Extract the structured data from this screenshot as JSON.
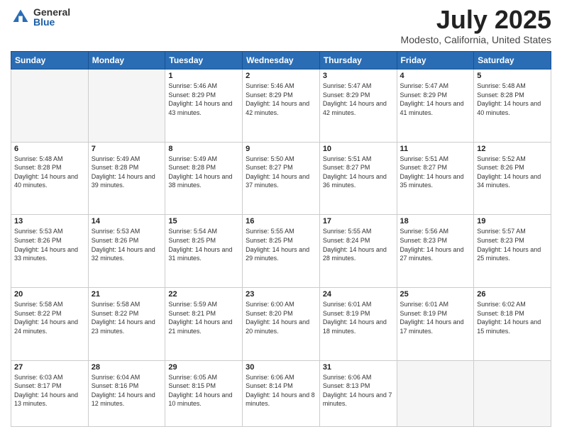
{
  "header": {
    "logo_general": "General",
    "logo_blue": "Blue",
    "month": "July 2025",
    "location": "Modesto, California, United States"
  },
  "weekdays": [
    "Sunday",
    "Monday",
    "Tuesday",
    "Wednesday",
    "Thursday",
    "Friday",
    "Saturday"
  ],
  "days": [
    {
      "num": "",
      "empty": true
    },
    {
      "num": "",
      "empty": true
    },
    {
      "num": "1",
      "sunrise": "Sunrise: 5:46 AM",
      "sunset": "Sunset: 8:29 PM",
      "daylight": "Daylight: 14 hours and 43 minutes."
    },
    {
      "num": "2",
      "sunrise": "Sunrise: 5:46 AM",
      "sunset": "Sunset: 8:29 PM",
      "daylight": "Daylight: 14 hours and 42 minutes."
    },
    {
      "num": "3",
      "sunrise": "Sunrise: 5:47 AM",
      "sunset": "Sunset: 8:29 PM",
      "daylight": "Daylight: 14 hours and 42 minutes."
    },
    {
      "num": "4",
      "sunrise": "Sunrise: 5:47 AM",
      "sunset": "Sunset: 8:29 PM",
      "daylight": "Daylight: 14 hours and 41 minutes."
    },
    {
      "num": "5",
      "sunrise": "Sunrise: 5:48 AM",
      "sunset": "Sunset: 8:28 PM",
      "daylight": "Daylight: 14 hours and 40 minutes."
    },
    {
      "num": "6",
      "sunrise": "Sunrise: 5:48 AM",
      "sunset": "Sunset: 8:28 PM",
      "daylight": "Daylight: 14 hours and 40 minutes."
    },
    {
      "num": "7",
      "sunrise": "Sunrise: 5:49 AM",
      "sunset": "Sunset: 8:28 PM",
      "daylight": "Daylight: 14 hours and 39 minutes."
    },
    {
      "num": "8",
      "sunrise": "Sunrise: 5:49 AM",
      "sunset": "Sunset: 8:28 PM",
      "daylight": "Daylight: 14 hours and 38 minutes."
    },
    {
      "num": "9",
      "sunrise": "Sunrise: 5:50 AM",
      "sunset": "Sunset: 8:27 PM",
      "daylight": "Daylight: 14 hours and 37 minutes."
    },
    {
      "num": "10",
      "sunrise": "Sunrise: 5:51 AM",
      "sunset": "Sunset: 8:27 PM",
      "daylight": "Daylight: 14 hours and 36 minutes."
    },
    {
      "num": "11",
      "sunrise": "Sunrise: 5:51 AM",
      "sunset": "Sunset: 8:27 PM",
      "daylight": "Daylight: 14 hours and 35 minutes."
    },
    {
      "num": "12",
      "sunrise": "Sunrise: 5:52 AM",
      "sunset": "Sunset: 8:26 PM",
      "daylight": "Daylight: 14 hours and 34 minutes."
    },
    {
      "num": "13",
      "sunrise": "Sunrise: 5:53 AM",
      "sunset": "Sunset: 8:26 PM",
      "daylight": "Daylight: 14 hours and 33 minutes."
    },
    {
      "num": "14",
      "sunrise": "Sunrise: 5:53 AM",
      "sunset": "Sunset: 8:26 PM",
      "daylight": "Daylight: 14 hours and 32 minutes."
    },
    {
      "num": "15",
      "sunrise": "Sunrise: 5:54 AM",
      "sunset": "Sunset: 8:25 PM",
      "daylight": "Daylight: 14 hours and 31 minutes."
    },
    {
      "num": "16",
      "sunrise": "Sunrise: 5:55 AM",
      "sunset": "Sunset: 8:25 PM",
      "daylight": "Daylight: 14 hours and 29 minutes."
    },
    {
      "num": "17",
      "sunrise": "Sunrise: 5:55 AM",
      "sunset": "Sunset: 8:24 PM",
      "daylight": "Daylight: 14 hours and 28 minutes."
    },
    {
      "num": "18",
      "sunrise": "Sunrise: 5:56 AM",
      "sunset": "Sunset: 8:23 PM",
      "daylight": "Daylight: 14 hours and 27 minutes."
    },
    {
      "num": "19",
      "sunrise": "Sunrise: 5:57 AM",
      "sunset": "Sunset: 8:23 PM",
      "daylight": "Daylight: 14 hours and 25 minutes."
    },
    {
      "num": "20",
      "sunrise": "Sunrise: 5:58 AM",
      "sunset": "Sunset: 8:22 PM",
      "daylight": "Daylight: 14 hours and 24 minutes."
    },
    {
      "num": "21",
      "sunrise": "Sunrise: 5:58 AM",
      "sunset": "Sunset: 8:22 PM",
      "daylight": "Daylight: 14 hours and 23 minutes."
    },
    {
      "num": "22",
      "sunrise": "Sunrise: 5:59 AM",
      "sunset": "Sunset: 8:21 PM",
      "daylight": "Daylight: 14 hours and 21 minutes."
    },
    {
      "num": "23",
      "sunrise": "Sunrise: 6:00 AM",
      "sunset": "Sunset: 8:20 PM",
      "daylight": "Daylight: 14 hours and 20 minutes."
    },
    {
      "num": "24",
      "sunrise": "Sunrise: 6:01 AM",
      "sunset": "Sunset: 8:19 PM",
      "daylight": "Daylight: 14 hours and 18 minutes."
    },
    {
      "num": "25",
      "sunrise": "Sunrise: 6:01 AM",
      "sunset": "Sunset: 8:19 PM",
      "daylight": "Daylight: 14 hours and 17 minutes."
    },
    {
      "num": "26",
      "sunrise": "Sunrise: 6:02 AM",
      "sunset": "Sunset: 8:18 PM",
      "daylight": "Daylight: 14 hours and 15 minutes."
    },
    {
      "num": "27",
      "sunrise": "Sunrise: 6:03 AM",
      "sunset": "Sunset: 8:17 PM",
      "daylight": "Daylight: 14 hours and 13 minutes."
    },
    {
      "num": "28",
      "sunrise": "Sunrise: 6:04 AM",
      "sunset": "Sunset: 8:16 PM",
      "daylight": "Daylight: 14 hours and 12 minutes."
    },
    {
      "num": "29",
      "sunrise": "Sunrise: 6:05 AM",
      "sunset": "Sunset: 8:15 PM",
      "daylight": "Daylight: 14 hours and 10 minutes."
    },
    {
      "num": "30",
      "sunrise": "Sunrise: 6:06 AM",
      "sunset": "Sunset: 8:14 PM",
      "daylight": "Daylight: 14 hours and 8 minutes."
    },
    {
      "num": "31",
      "sunrise": "Sunrise: 6:06 AM",
      "sunset": "Sunset: 8:13 PM",
      "daylight": "Daylight: 14 hours and 7 minutes."
    },
    {
      "num": "",
      "empty": true
    },
    {
      "num": "",
      "empty": true
    }
  ]
}
